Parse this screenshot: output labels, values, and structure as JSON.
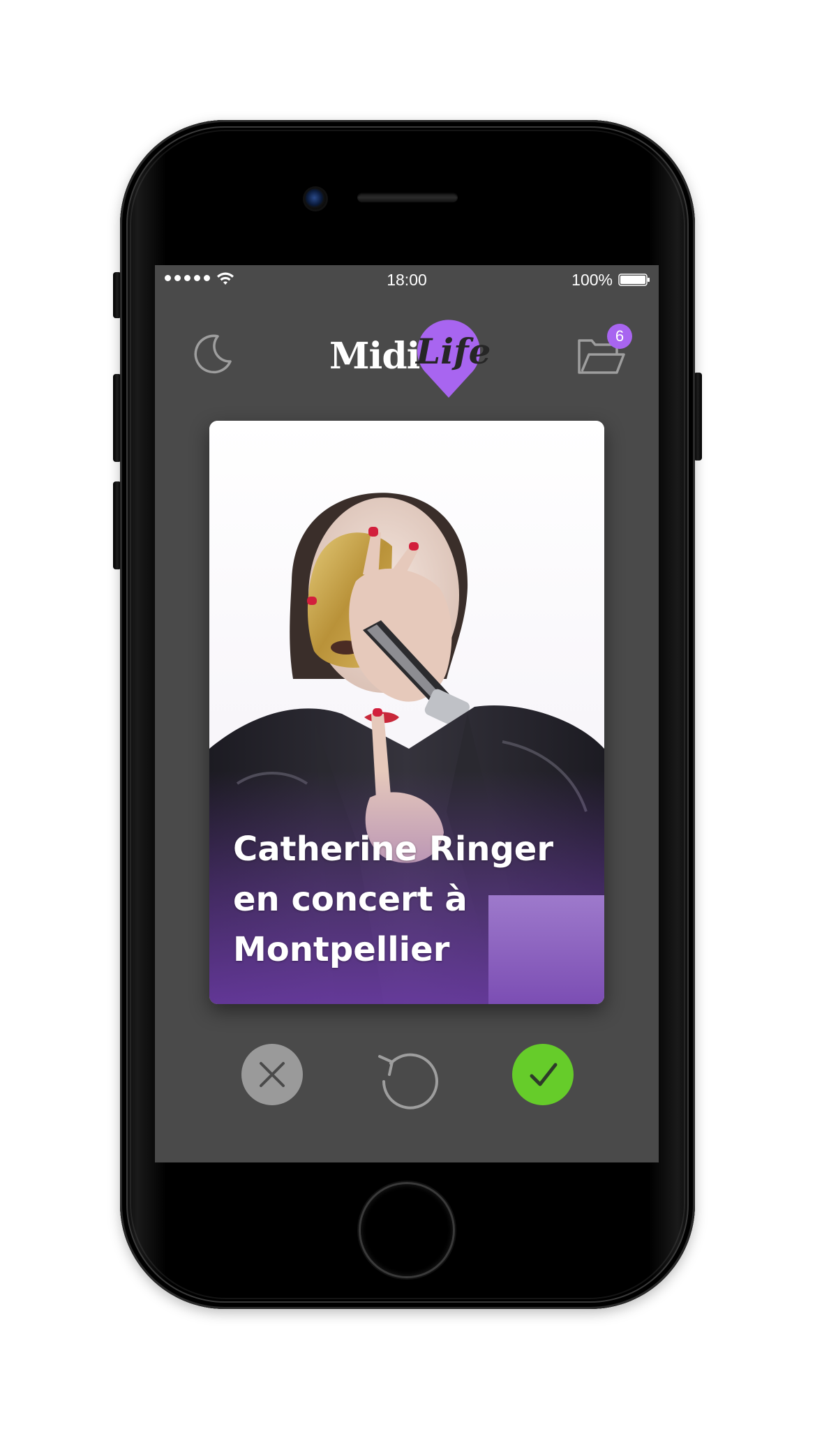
{
  "status_bar": {
    "time": "18:00",
    "battery_percent": "100%",
    "signal_icon": "signal-dots-icon",
    "wifi_icon": "wifi-icon",
    "battery_icon": "battery-full-icon"
  },
  "nav": {
    "night_mode_icon": "moon-icon",
    "logo": {
      "word1": "Midi",
      "word2": "Life",
      "accent_color": "#a865f0"
    },
    "saved_icon": "folder-icon",
    "saved_count": "6"
  },
  "card": {
    "title": "Catherine Ringer en concert à Montpellier",
    "overlay_color": "#6e3caa"
  },
  "actions": {
    "reject_icon": "close-icon",
    "undo_icon": "undo-icon",
    "accept_icon": "checkmark-icon",
    "reject_color": "#9a9a9a",
    "accept_color": "#66cc2a"
  }
}
